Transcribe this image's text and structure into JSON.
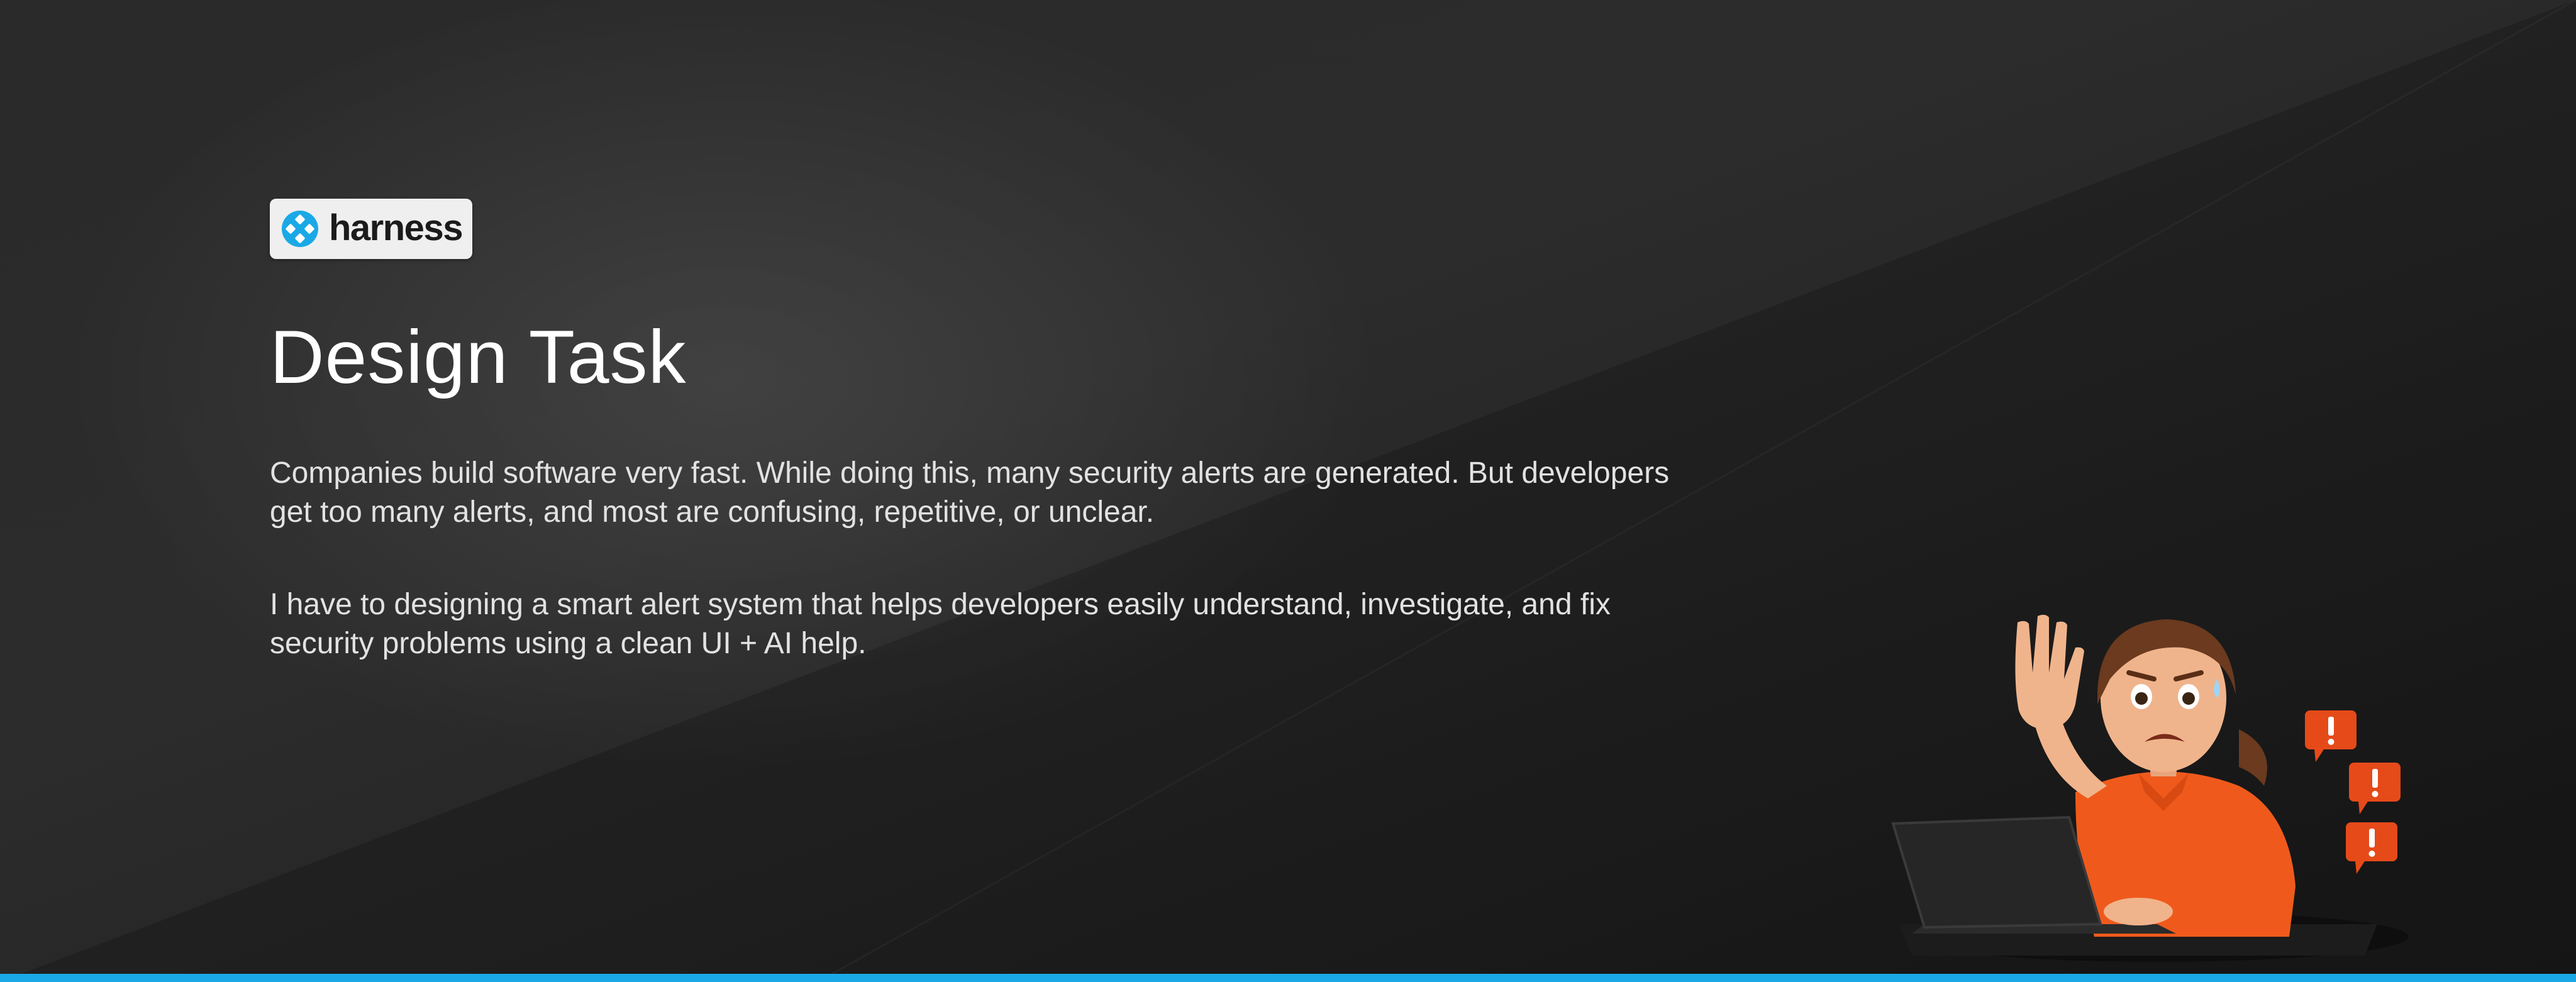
{
  "brand": {
    "name": "harness",
    "logo_icon": "harness-logo-icon",
    "accent_color": "#1aa9e6"
  },
  "slide": {
    "title": "Design Task",
    "paragraphs": [
      "Companies build software very fast. While doing this, many security alerts are generated. But developers get too many alerts, and most are confusing, repetitive, or unclear.",
      "I have to designing a smart alert system that helps developers easily understand, investigate, and fix security problems using a clean UI + AI help."
    ]
  },
  "illustration": {
    "icon": "stressed-developer-illustration",
    "alert_icon": "alert-bubble-icon",
    "alert_color": "#e64a19",
    "shirt_color": "#ef5a1c"
  },
  "colors": {
    "background": "#262626",
    "text": "#e2e2e2",
    "title": "#ffffff",
    "bottom_bar": "#1aa9e6"
  }
}
